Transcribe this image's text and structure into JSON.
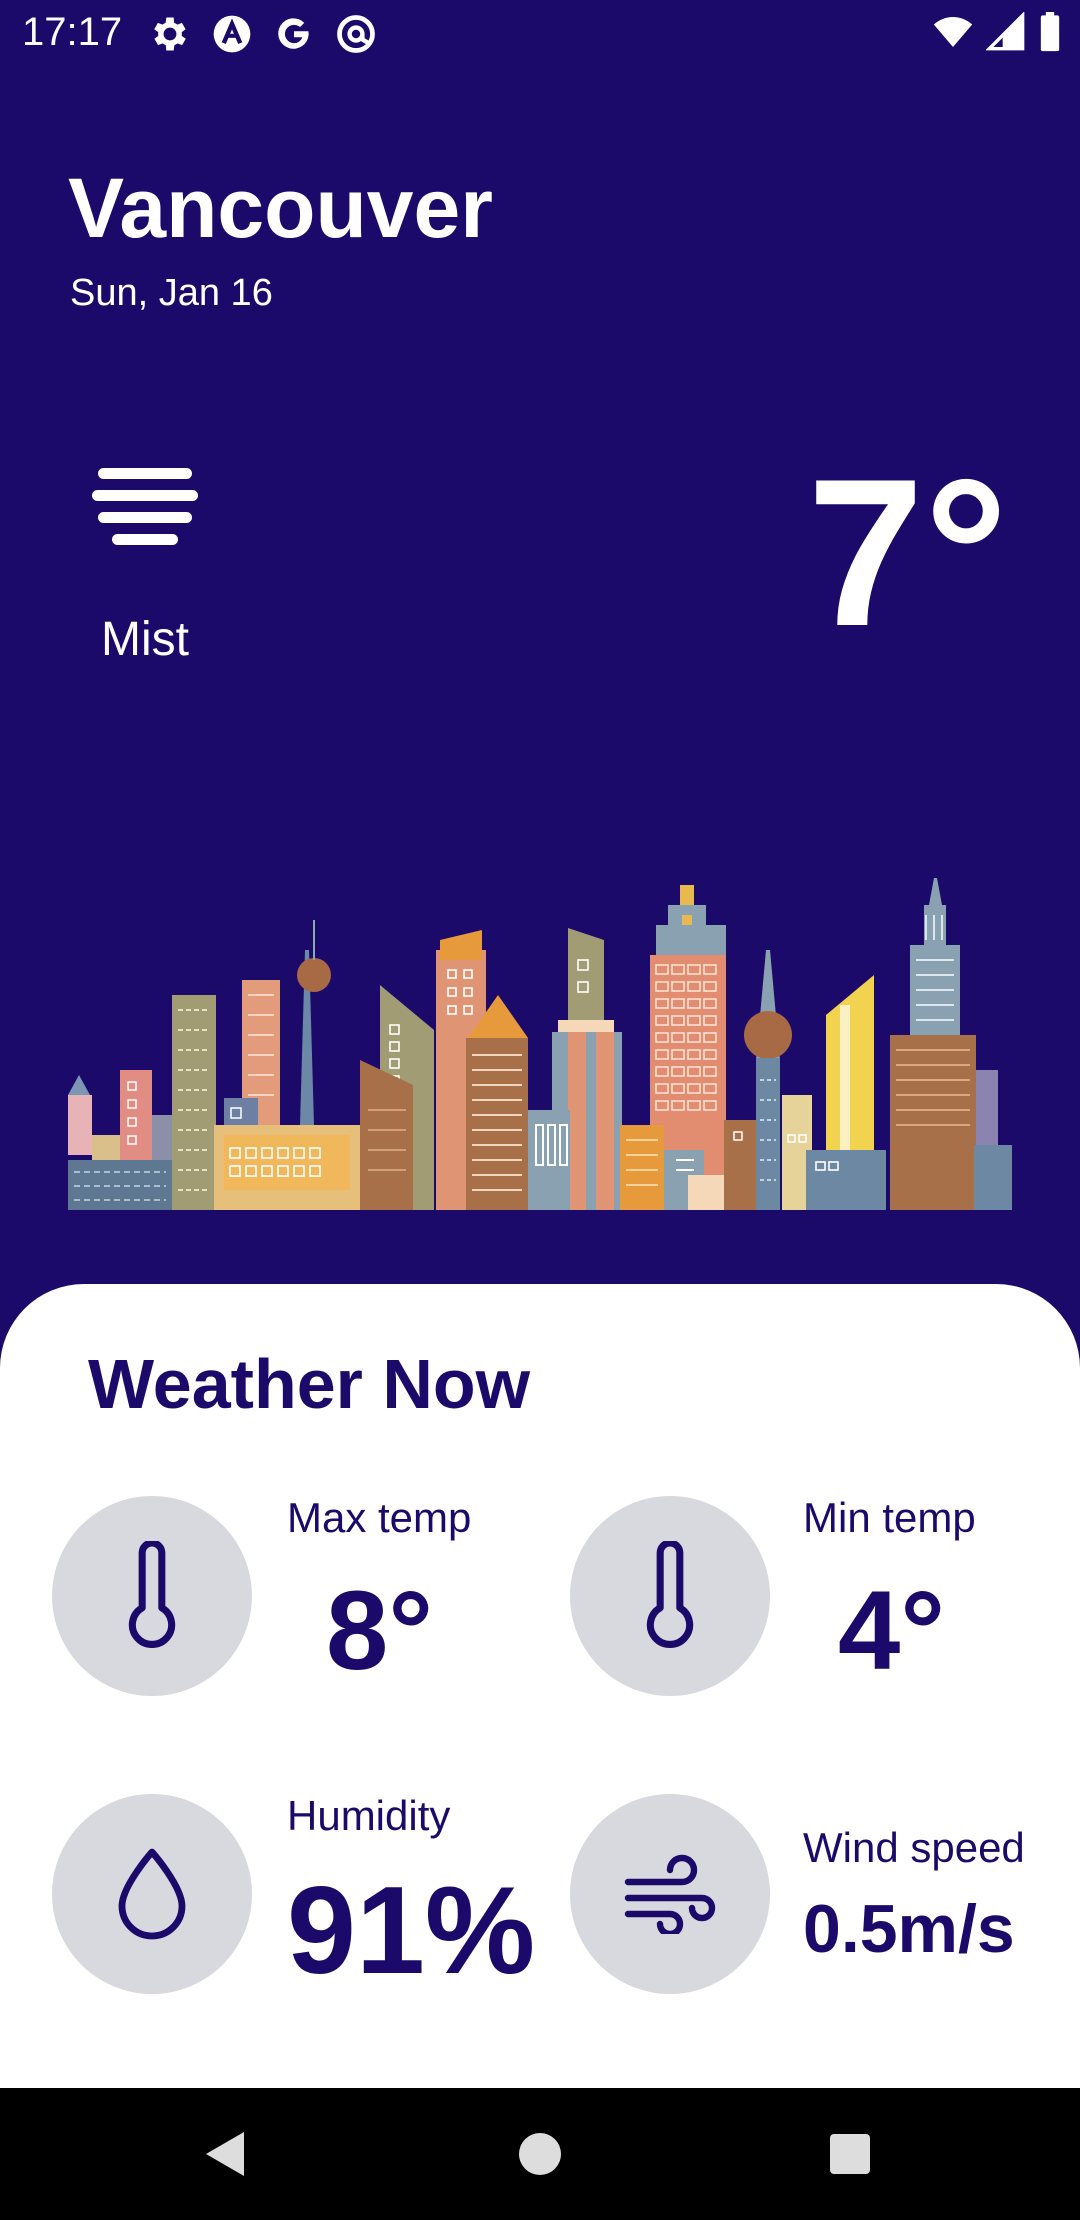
{
  "status_bar": {
    "time": "17:17",
    "left_icons": [
      "gear-icon",
      "a-circle-icon",
      "google-g-icon",
      "at-circle-icon"
    ],
    "right_icons": [
      "wifi-icon",
      "signal-icon",
      "battery-icon"
    ]
  },
  "header": {
    "city": "Vancouver",
    "date": "Sun, Jan 16"
  },
  "current": {
    "condition_icon": "mist-icon",
    "condition": "Mist",
    "temperature": "7°"
  },
  "weather_now": {
    "title": "Weather Now",
    "max_temp": {
      "label": "Max temp",
      "value": "8°",
      "icon": "thermometer-icon"
    },
    "min_temp": {
      "label": "Min temp",
      "value": "4°",
      "icon": "thermometer-icon"
    },
    "humidity": {
      "label": "Humidity",
      "value": "91%",
      "icon": "droplet-icon"
    },
    "wind_speed": {
      "label": "Wind speed",
      "value": "0.5m/s",
      "icon": "wind-icon"
    }
  },
  "nav_bar": {
    "buttons": [
      "back-icon",
      "home-icon",
      "recents-icon"
    ]
  },
  "colors": {
    "background": "#1c0a6b",
    "card": "#ffffff",
    "accent_text": "#1c0a6b",
    "icon_circle": "#d7d9de"
  }
}
